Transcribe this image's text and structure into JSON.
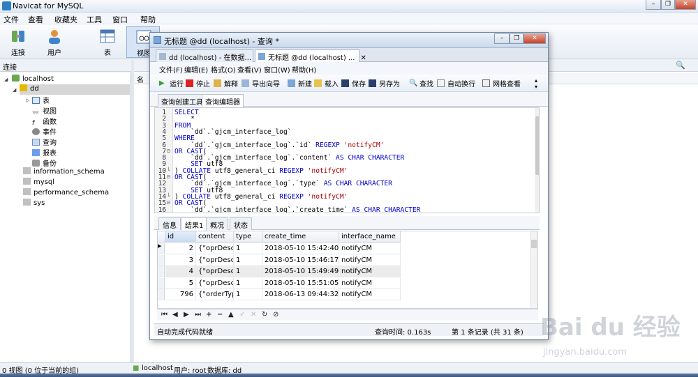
{
  "app": {
    "title": "Navicat for MySQL"
  },
  "menu": [
    "文件",
    "查看",
    "收藏夹",
    "工具",
    "窗口",
    "帮助"
  ],
  "toolbar": [
    "连接",
    "用户",
    "表",
    "视图"
  ],
  "left_panel": {
    "header": "连接"
  },
  "tree": {
    "connection": "localhost",
    "database": "dd",
    "children": [
      "表",
      "视图",
      "函数",
      "事件",
      "查询",
      "报表",
      "备份"
    ],
    "other_dbs": [
      "information_schema",
      "mysql",
      "performance_schema",
      "sys"
    ]
  },
  "right_panel": {
    "column_header": "名"
  },
  "status": {
    "left": "0 视图 (0 位于当前的组)",
    "connection": "localhost",
    "user": "用户: root",
    "database": "数据库: dd"
  },
  "query_window": {
    "title": "无标题 @dd (localhost) - 查询 *",
    "tabs": [
      "dd (localhost) - 在数据...",
      "无标题 @dd (localhost) ..."
    ],
    "menu": [
      "文件(F)",
      "编辑(E)",
      "格式(O)",
      "查看(V)",
      "窗口(W)",
      "帮助(H)"
    ],
    "tools": [
      "运行",
      "停止",
      "解释",
      "导出向导",
      "新建",
      "载入",
      "保存",
      "另存为",
      "查找",
      "自动换行",
      "网格查看"
    ],
    "sub_tabs": [
      "查询创建工具",
      "查询编辑器"
    ],
    "sql_lines": [
      [
        "SELECT"
      ],
      [
        "    *"
      ],
      [
        "FROM"
      ],
      [
        "    `dd`.`gjcm_interface_log`"
      ],
      [
        "WHERE"
      ],
      [
        "    `dd`.`gjcm_interface_log`.`id` REGEXP 'notifyCM'"
      ],
      [
        "OR CAST("
      ],
      [
        "    `dd`.`gjcm_interface_log`.`content` AS CHAR CHARACTER"
      ],
      [
        "    SET utf8"
      ],
      [
        ") COLLATE utf8_general_ci REGEXP 'notifyCM'"
      ],
      [
        "OR CAST("
      ],
      [
        "    `dd`.`gjcm_interface_log`.`type` AS CHAR CHARACTER"
      ],
      [
        "    SET utf8"
      ],
      [
        ") COLLATE utf8_general_ci REGEXP 'notifyCM'"
      ],
      [
        "OR CAST("
      ],
      [
        "    `dd`.`gjcm_interface_log`.`create_time` AS CHAR CHARACTER"
      ]
    ],
    "line_numbers": [
      "1",
      "2",
      "3",
      "4",
      "5",
      "6",
      "7",
      "8",
      "9",
      "10",
      "11",
      "12",
      "13",
      "14",
      "15",
      "16"
    ],
    "result_tabs": [
      "信息",
      "结果1",
      "概况",
      "状态"
    ],
    "columns": [
      "id",
      "content",
      "type",
      "create_time",
      "interface_name"
    ],
    "rows": [
      [
        "2",
        "{\"oprDescrip",
        "1",
        "2018-05-10 15:42:40",
        "notifyCM"
      ],
      [
        "3",
        "{\"oprDescrip",
        "1",
        "2018-05-10 15:46:17",
        "notifyCM"
      ],
      [
        "4",
        "{\"oprDescrip",
        "1",
        "2018-05-10 15:49:49",
        "notifyCM"
      ],
      [
        "5",
        "{\"oprDescrip",
        "1",
        "2018-05-10 15:51:05",
        "notifyCM"
      ],
      [
        "796",
        "{\"orderType",
        "1",
        "2018-06-13 09:44:32",
        "notifyCM"
      ]
    ],
    "status": {
      "left": "自动完成代码就绪",
      "time": "查询时间: 0.163s",
      "records": "第 1 条记录 (共 31 条)"
    }
  },
  "watermark": {
    "brand": "Bai du 经验",
    "url": "jingyan.baidu.com"
  }
}
